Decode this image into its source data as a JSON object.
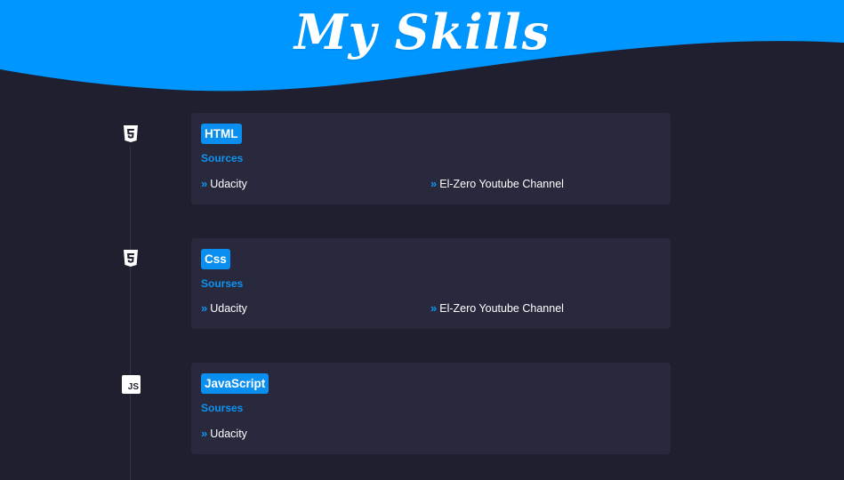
{
  "header": {
    "title": "My Skills",
    "colors": {
      "wave": "#0096ff",
      "background": "#1f1f30"
    }
  },
  "skills": [
    {
      "icon": "html5-icon",
      "name": "HTML",
      "sources_label": "Sources",
      "sources": [
        "Udacity",
        "El-Zero Youtube Channel"
      ]
    },
    {
      "icon": "css3-icon",
      "name": "Css",
      "sources_label": "Sourses",
      "sources": [
        "Udacity",
        "El-Zero Youtube Channel"
      ]
    },
    {
      "icon": "js-icon",
      "name": "JavaScript",
      "sources_label": "Sourses",
      "sources": [
        "Udacity"
      ],
      "icon_text": "JS"
    }
  ],
  "colors": {
    "accent": "#0a8ff0",
    "card": "#29293d"
  }
}
